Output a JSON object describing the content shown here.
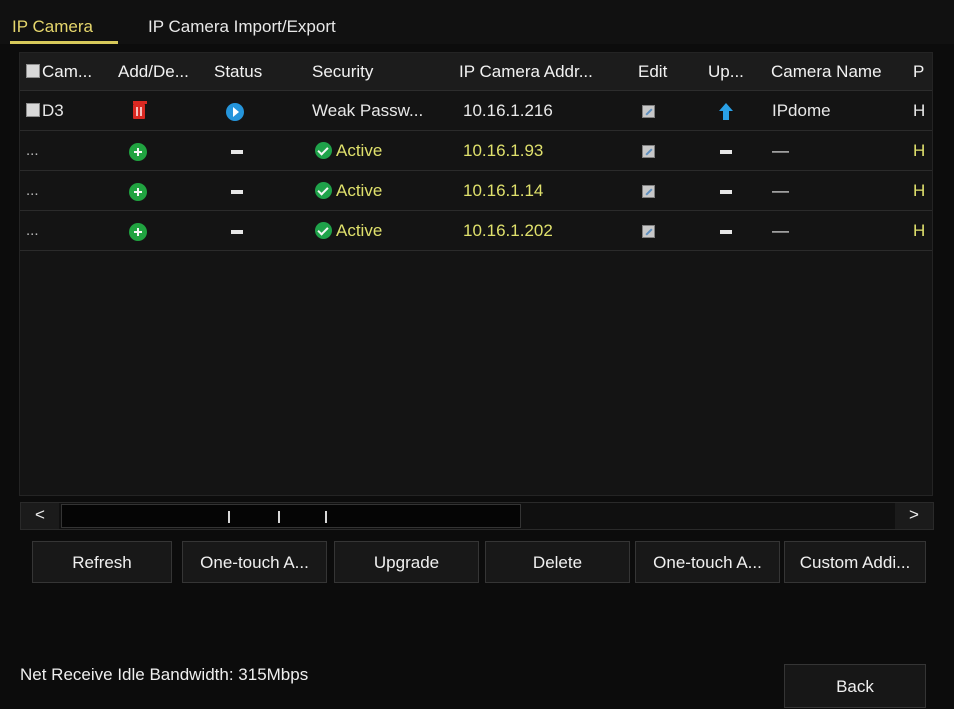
{
  "tabs": [
    {
      "label": "IP Camera"
    },
    {
      "label": "IP Camera Import/Export"
    }
  ],
  "table": {
    "headers": [
      "Cam...",
      "Add/De...",
      "Status",
      "Security",
      "IP Camera Addr...",
      "Edit",
      "Up...",
      "Camera Name",
      "P"
    ],
    "rows": [
      {
        "camera": "D3",
        "status_icon": "play-icon",
        "security": "Weak Passw...",
        "ip": "10.16.1.216",
        "camera_name": "IPdome",
        "protocol": "H",
        "add_delete_icon": "trash-icon",
        "upgrade_icon": "upgrade-icon"
      },
      {
        "camera": "...",
        "status_icon": "dash-icon",
        "security": "Active",
        "ip": "10.16.1.93",
        "camera_name": "—",
        "protocol": "H",
        "add_delete_icon": "add-icon",
        "upgrade_icon": "dash-icon"
      },
      {
        "camera": "...",
        "status_icon": "dash-icon",
        "security": "Active",
        "ip": "10.16.1.14",
        "camera_name": "—",
        "protocol": "H",
        "add_delete_icon": "add-icon",
        "upgrade_icon": "dash-icon"
      },
      {
        "camera": "...",
        "status_icon": "dash-icon",
        "security": "Active",
        "ip": "10.16.1.202",
        "camera_name": "—",
        "protocol": "H",
        "add_delete_icon": "add-icon",
        "upgrade_icon": "dash-icon"
      }
    ]
  },
  "scroll": {
    "left": "<",
    "right": ">"
  },
  "buttons": [
    {
      "label": "Refresh"
    },
    {
      "label": "One-touch A..."
    },
    {
      "label": "Upgrade"
    },
    {
      "label": "Delete"
    },
    {
      "label": "One-touch A..."
    },
    {
      "label": "Custom Addi..."
    }
  ],
  "footer": {
    "bandwidth_text": "Net Receive Idle Bandwidth: 315Mbps",
    "back_label": "Back"
  },
  "colors": {
    "active_tab": "#e5d66c",
    "ip_text": "#dfe06c",
    "active_icon": "#1fa24a",
    "delete_icon": "#d92922",
    "status_icon": "#2595db"
  }
}
